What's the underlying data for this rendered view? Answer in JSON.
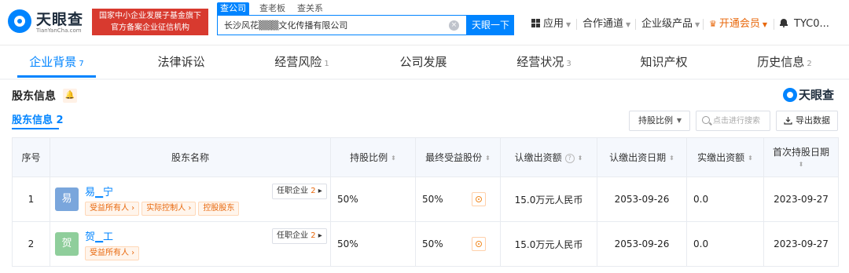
{
  "header": {
    "logo_text": "天眼查",
    "logo_sub": "TianYanCha.com",
    "badge_line1": "国家中小企业发展子基金旗下",
    "badge_line2": "官方备案企业征信机构",
    "search_tabs": [
      "查公司",
      "查老板",
      "查关系"
    ],
    "search_value": "长沙风花▒▒▒文化传播有限公司",
    "clear_icon": "×",
    "search_button": "天眼一下",
    "nav": {
      "app": "应用",
      "channel": "合作通道",
      "enterprise": "企业级产品",
      "vip": "开通会员",
      "user": "TYC0..."
    },
    "caret": "▼"
  },
  "tabs": [
    {
      "label": "企业背景",
      "count": "7"
    },
    {
      "label": "法律诉讼",
      "count": ""
    },
    {
      "label": "经营风险",
      "count": "1"
    },
    {
      "label": "公司发展",
      "count": ""
    },
    {
      "label": "经营状况",
      "count": "3"
    },
    {
      "label": "知识产权",
      "count": ""
    },
    {
      "label": "历史信息",
      "count": "2"
    }
  ],
  "section": {
    "title": "股东信息",
    "subtab_label": "股东信息",
    "subtab_count": "2",
    "brand": "天眼查",
    "ratio_button": "持股比例",
    "search_placeholder": "点击进行搜索",
    "export_button": "导出数据"
  },
  "table": {
    "headers": [
      "序号",
      "股东名称",
      "持股比例",
      "最终受益股份",
      "认缴出资额",
      "认缴出资日期",
      "实缴出资额",
      "首次持股日期"
    ],
    "rows": [
      {
        "index": "1",
        "avatar": "易",
        "avatar_color": "#7aa6dc",
        "name": "易▁宁",
        "tags": [
          "受益所有人",
          "实际控制人",
          "控股股东"
        ],
        "job_label": "任职企业",
        "job_count": "2",
        "ratio": "50%",
        "benefit": "50%",
        "subscribed": "15.0万元人民币",
        "sub_date": "2053-09-26",
        "paid": "0.0",
        "first_date": "2023-09-27"
      },
      {
        "index": "2",
        "avatar": "贺",
        "avatar_color": "#8fce9b",
        "name": "贺▁工",
        "tags": [
          "受益所有人"
        ],
        "job_label": "任职企业",
        "job_count": "2",
        "ratio": "50%",
        "benefit": "50%",
        "subscribed": "15.0万元人民币",
        "sub_date": "2053-09-26",
        "paid": "0.0",
        "first_date": "2023-09-27"
      }
    ]
  },
  "colors": {
    "accent": "#0084ff",
    "tag": "#e8670b",
    "badge": "#d83a2f"
  }
}
